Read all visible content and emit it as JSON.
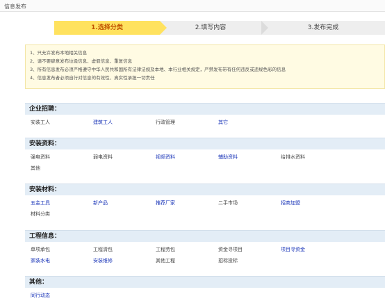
{
  "header": {
    "title": "信息发布"
  },
  "steps": [
    "1.选择分类",
    "2.填写内容",
    "3.发布完成"
  ],
  "notice": [
    "1、只允许发布本地相关信息",
    "2、请不要肆意发布垃圾信息、虚假信息、重复信息",
    "3、所有信息发布必须严格遵守中华人民共和国所有法律法规及本地、本行业相关规定，严禁发布带有任何违反或违规色彩的信息",
    "4、信息发布者必须自行对信息的有效性、真实性承担一切责任"
  ],
  "sections": [
    {
      "title": "企业招聘：",
      "items": [
        {
          "label": "安装工人",
          "link": false
        },
        {
          "label": "建筑工人",
          "link": true
        },
        {
          "label": "行政管理",
          "link": false
        },
        {
          "label": "其它",
          "link": true
        }
      ]
    },
    {
      "title": "安装资料：",
      "items": [
        {
          "label": "强电资料",
          "link": false
        },
        {
          "label": "弱电资料",
          "link": false
        },
        {
          "label": "视频资料",
          "link": true
        },
        {
          "label": "辅助资料",
          "link": true
        },
        {
          "label": "给排水资料",
          "link": false
        },
        {
          "label": "其他",
          "link": false
        }
      ]
    },
    {
      "title": "安装材料：",
      "items": [
        {
          "label": "五金工具",
          "link": true
        },
        {
          "label": "新产品",
          "link": true
        },
        {
          "label": "推荐厂家",
          "link": true
        },
        {
          "label": "二手市场",
          "link": false
        },
        {
          "label": "招商加盟",
          "link": true
        },
        {
          "label": "材料分类",
          "link": false
        }
      ]
    },
    {
      "title": "工程信息：",
      "items": [
        {
          "label": "单项承包",
          "link": false
        },
        {
          "label": "工程清包",
          "link": false
        },
        {
          "label": "工程劳包",
          "link": false
        },
        {
          "label": "资金寻项目",
          "link": false
        },
        {
          "label": "项目寻资金",
          "link": true
        },
        {
          "label": "家装水电",
          "link": true
        },
        {
          "label": "安装维修",
          "link": true
        },
        {
          "label": "其他工程",
          "link": false
        },
        {
          "label": "招标投标",
          "link": false
        }
      ]
    },
    {
      "title": "其他：",
      "items": [
        {
          "label": "同行动态",
          "link": true
        }
      ]
    }
  ]
}
